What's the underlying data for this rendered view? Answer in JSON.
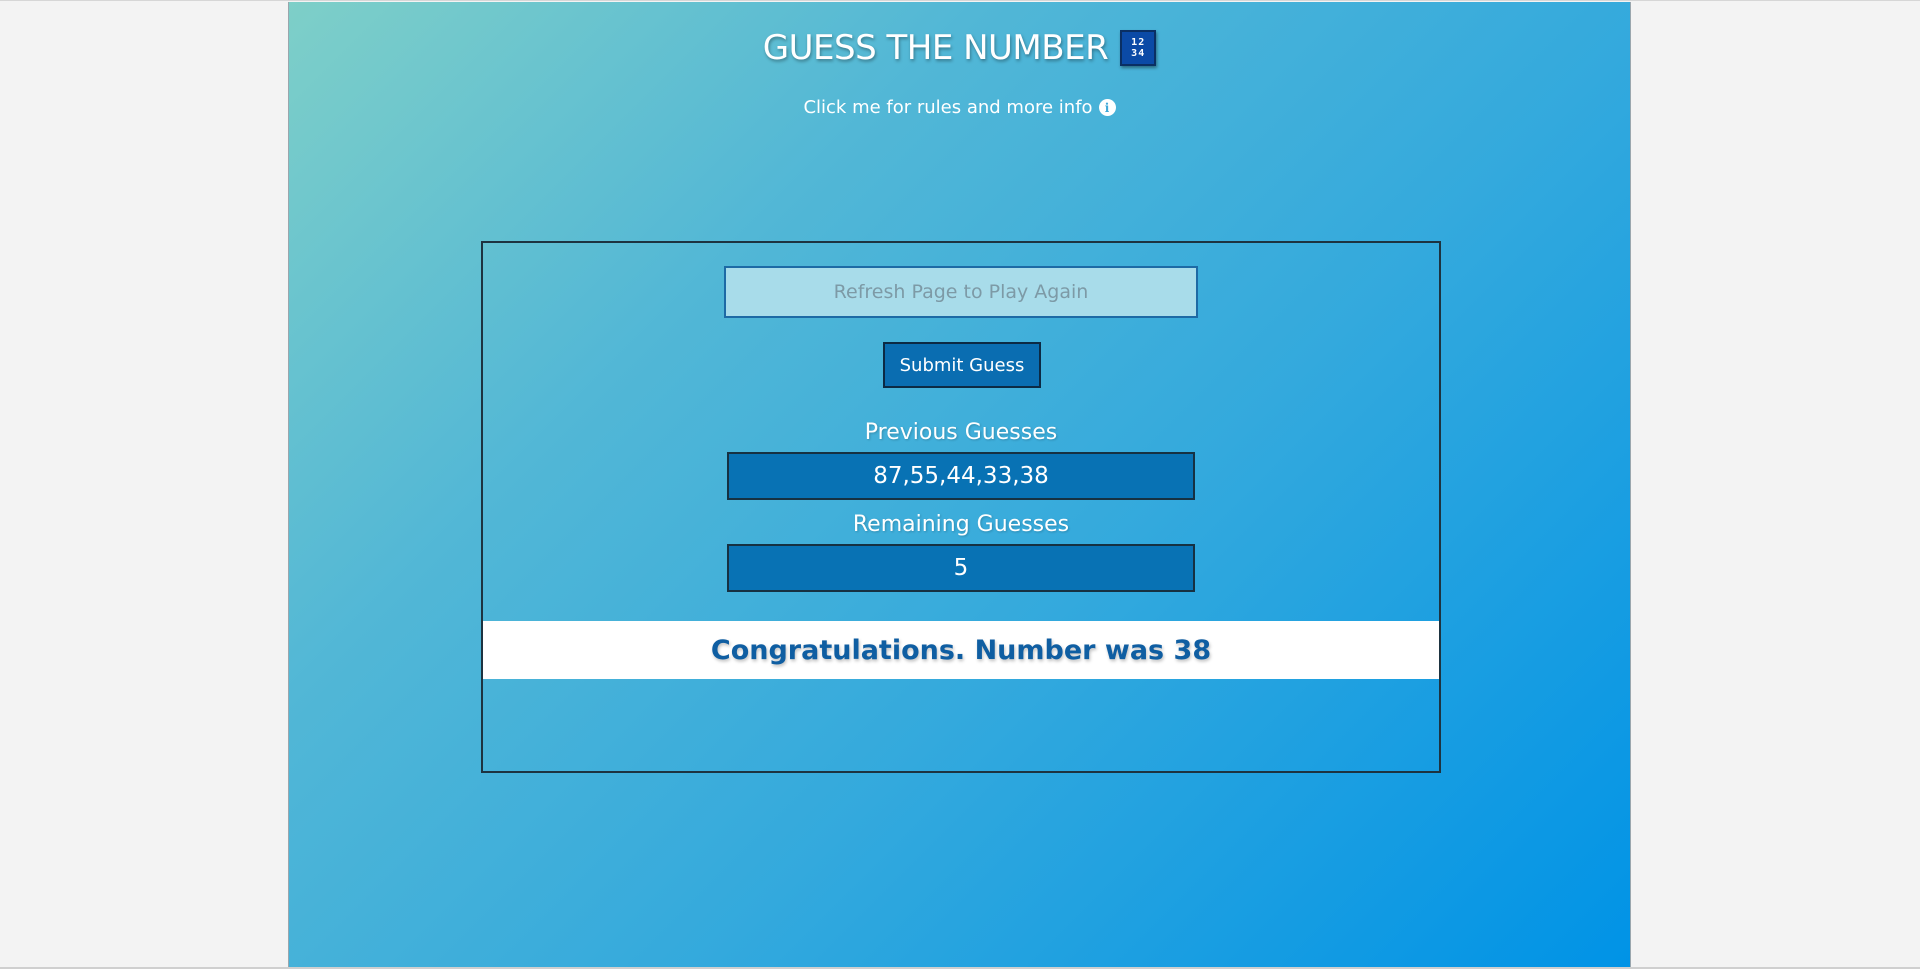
{
  "header": {
    "title": "GUESS THE NUMBER",
    "icon_top": "12",
    "icon_bottom": "34",
    "info_link": "Click me for rules and more info",
    "info_icon": "i"
  },
  "game": {
    "guess_input_placeholder": "Refresh Page to Play Again",
    "submit_label": "Submit Guess",
    "previous_label": "Previous Guesses",
    "previous_value": "87,55,44,33,38",
    "remaining_label": "Remaining Guesses",
    "remaining_value": "5",
    "result_message": "Congratulations. Number was 38"
  },
  "colors": {
    "gradient_start": "#7ecfc8",
    "gradient_end": "#0093e6",
    "box_fill": "#0872b4",
    "result_text": "#0f5ea2"
  }
}
